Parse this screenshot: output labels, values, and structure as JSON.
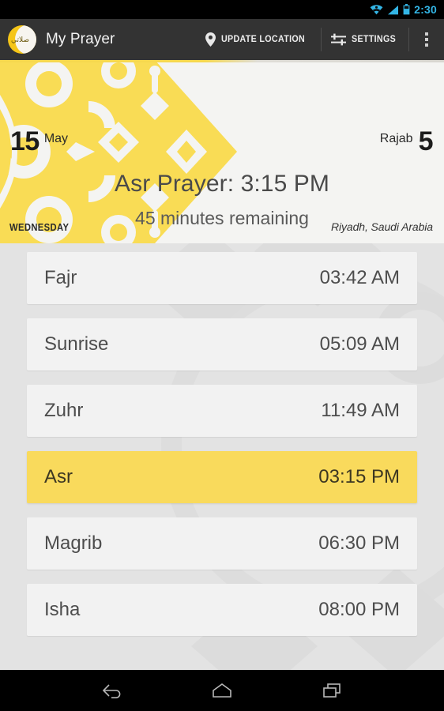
{
  "statusbar": {
    "time": "2:30",
    "icons": [
      "wifi-icon",
      "signal-icon",
      "battery-icon"
    ],
    "accent_color": "#33b5e5"
  },
  "actionbar": {
    "app_title": "My Prayer",
    "logo_arabic": "صلاتي",
    "update_location_label": "UPDATE LOCATION",
    "settings_label": "SETTINGS",
    "background_color": "#333333"
  },
  "banner": {
    "gregorian_day": "15",
    "gregorian_month": "May",
    "hijri_month": "Rajab",
    "hijri_day": "5",
    "next_prayer": "Asr Prayer: 3:15 PM",
    "remaining": "45 minutes remaining",
    "weekday": "WEDNESDAY",
    "location": "Riyadh, Saudi Arabia",
    "accent_color": "#f6d84e",
    "background_color": "#f4f4f2"
  },
  "prayers": [
    {
      "name": "Fajr",
      "time": "03:42 AM",
      "active": false
    },
    {
      "name": "Sunrise",
      "time": "05:09 AM",
      "active": false
    },
    {
      "name": "Zuhr",
      "time": "11:49 AM",
      "active": false
    },
    {
      "name": "Asr",
      "time": "03:15 PM",
      "active": true
    },
    {
      "name": "Magrib",
      "time": "06:30 PM",
      "active": false
    },
    {
      "name": "Isha",
      "time": "08:00 PM",
      "active": false
    }
  ],
  "list": {
    "row_color": "#f2f2f2",
    "active_row_color": "#f9da5c",
    "background_color": "#e3e3e3"
  },
  "navbar": {
    "back_label": "Back",
    "home_label": "Home",
    "recents_label": "Recent apps"
  }
}
